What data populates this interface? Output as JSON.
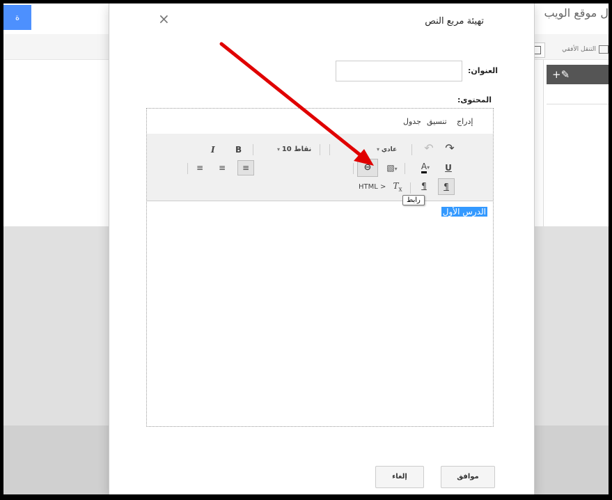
{
  "background": {
    "site_title": "ل موقع الويب",
    "horizontal_nav_label": "التنقل الأفقي",
    "blue_button_label": "ة",
    "dark_bar_label": "+✎"
  },
  "dialog": {
    "title": "تهيئة مربع النص",
    "close_symbol": "×",
    "title_label": "العنوان:",
    "content_label": "المحتوى:",
    "menu": {
      "insert": "إدراج",
      "format": "تنسيق",
      "table": "جدول"
    },
    "toolbar": {
      "italic": "I",
      "bold": "B",
      "font_size": "10 نقاط",
      "style": "عادي",
      "underline": "U",
      "html": "HTML",
      "link_tooltip": "رابط"
    },
    "content_text": "الدرس الأول",
    "ok_label": "موافق",
    "cancel_label": "إلغاء"
  },
  "colors": {
    "accent": "#4d90fe",
    "selection": "#3399ff",
    "arrow": "#e00000"
  }
}
